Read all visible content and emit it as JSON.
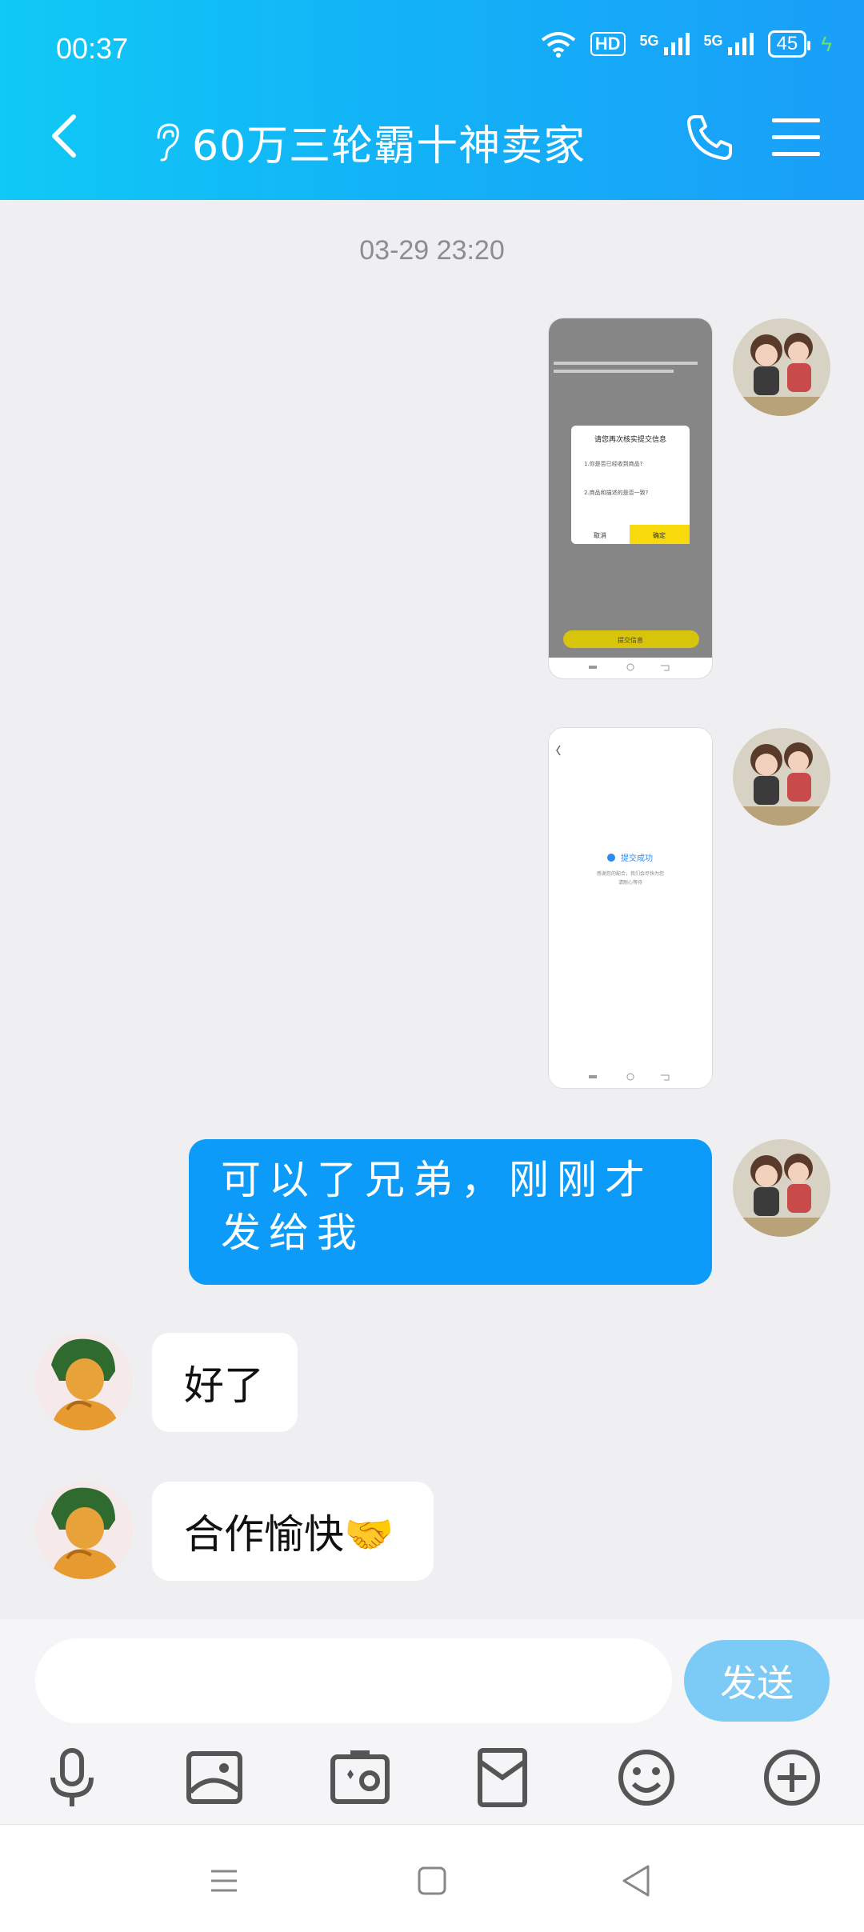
{
  "status_bar": {
    "time": "00:37",
    "hd": "HD",
    "network_1": "5G",
    "network_2": "5G",
    "battery": "45"
  },
  "header": {
    "title": "60万三轮霸十神卖家"
  },
  "chat": {
    "timestamp": "03-29 23:20",
    "screenshot_1": {
      "dialog_title": "请您再次核实提交信息",
      "q1": "1.你是否已经收到商品?",
      "q2": "2.商品和描述的是否一致?",
      "cancel": "取消",
      "confirm": "确定",
      "submit": "提交信息"
    },
    "screenshot_2": {
      "success": "提交成功",
      "line1": "感谢您的配合，我们会尽快为您",
      "line2": "请耐心等待"
    },
    "outgoing_text": "可以了兄弟，刚刚才发给我",
    "incoming_1": "好了",
    "incoming_2": "合作愉快🤝"
  },
  "input_bar": {
    "placeholder": "",
    "send_label": "发送"
  },
  "toolbar": {
    "icons": [
      "mic-icon",
      "image-icon",
      "camera-icon",
      "red-packet-icon",
      "emoji-icon",
      "plus-icon"
    ]
  }
}
